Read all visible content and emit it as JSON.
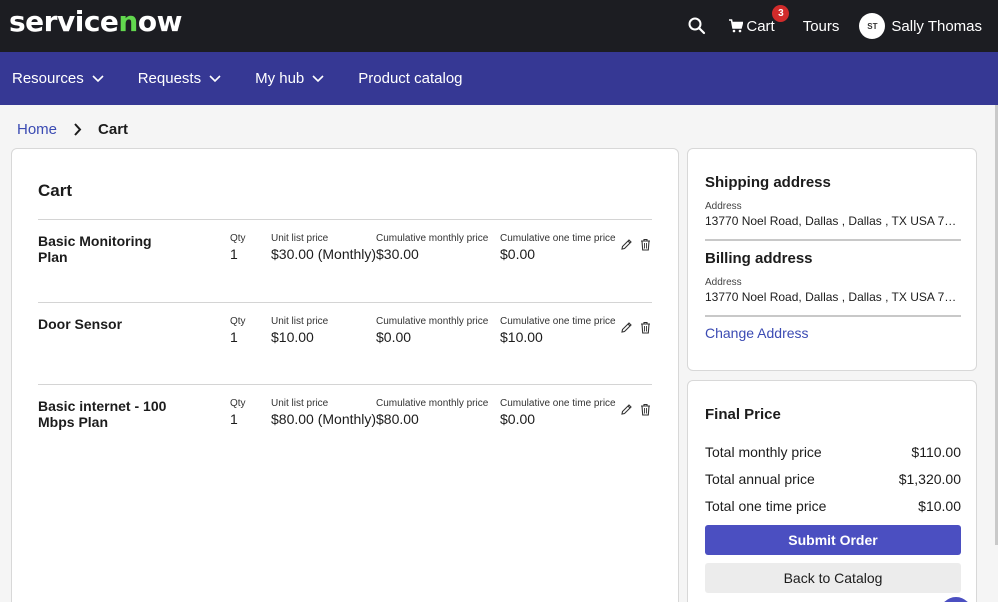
{
  "header": {
    "logo": "servicenow",
    "cart_label": "Cart",
    "cart_count": "3",
    "tours_label": "Tours",
    "user_initials": "ST",
    "user_name": "Sally Thomas"
  },
  "nav": {
    "items": [
      {
        "label": "Resources"
      },
      {
        "label": "Requests"
      },
      {
        "label": "My hub"
      },
      {
        "label": "Product catalog"
      }
    ]
  },
  "breadcrumb": {
    "home": "Home",
    "current": "Cart"
  },
  "cart": {
    "title": "Cart",
    "col_labels": {
      "qty": "Qty",
      "unit": "Unit list price",
      "monthly": "Cumulative monthly price",
      "once": "Cumulative one time price"
    },
    "items": [
      {
        "name": "Basic Monitoring Plan",
        "qty": "1",
        "unit": "$30.00 (Monthly)",
        "monthly": "$30.00",
        "once": "$0.00"
      },
      {
        "name": "Door Sensor",
        "qty": "1",
        "unit": "$10.00",
        "monthly": "$0.00",
        "once": "$10.00"
      },
      {
        "name": "Basic internet - 100 Mbps Plan",
        "qty": "1",
        "unit": "$80.00 (Monthly)",
        "monthly": "$80.00",
        "once": "$0.00"
      }
    ]
  },
  "shipping": {
    "title": "Shipping address",
    "address_label": "Address",
    "address": "13770 Noel Road, Dallas , Dallas , TX USA 752..."
  },
  "billing": {
    "title": "Billing address",
    "address_label": "Address",
    "address": "13770 Noel Road, Dallas , Dallas , TX USA 752..."
  },
  "change_address": "Change Address",
  "final_price": {
    "title": "Final Price",
    "rows": [
      {
        "label": "Total monthly price",
        "value": "$110.00"
      },
      {
        "label": "Total annual price",
        "value": "$1,320.00"
      },
      {
        "label": "Total one time price",
        "value": "$10.00"
      }
    ],
    "submit": "Submit Order",
    "back": "Back to Catalog"
  },
  "colors": {
    "topbar": "#1c1d22",
    "navbar": "#363894",
    "accent": "#4b4fc1",
    "link": "#3b4bb3",
    "badge": "#d12b2b"
  }
}
